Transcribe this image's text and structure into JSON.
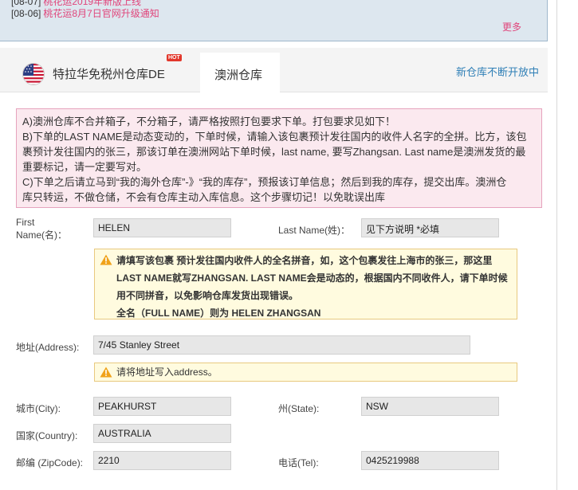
{
  "notices": {
    "clipped_row": {
      "date": "[08-07]",
      "title": "桃花运2019年新版上线"
    },
    "row2": {
      "date": "[08-06]",
      "title": "桃花运8月7日官网升级通知"
    },
    "more_label": "更多"
  },
  "tabs": {
    "us": {
      "label": "特拉华免税州仓库DE",
      "hot": "HOT",
      "flag_icon": "us-flag-icon"
    },
    "au": {
      "label": "澳洲仓库"
    },
    "new_warehouse": "新仓库不断开放中"
  },
  "instructions": {
    "line_a": "A)澳洲仓库不合并箱子，不分箱子，请严格按照打包要求下单。打包要求见如下！",
    "line_b1": "B)下单的LAST NAME是动态变动的，下单时候，请输入该包裹预计发往国内的收件人名字的全拼。比方，该包",
    "line_b2": "裹预计发往国内的张三，那该订单在澳洲网站下单时候，last name, 要写Zhangsan. Last name是澳洲发货的最",
    "line_b3": "重要标记，请一定要写对。",
    "line_c1": "C)下单之后请立马到“我的海外仓库”-》“我的库存”，预报该订单信息；然后到我的库存，提交出库。澳洲仓",
    "line_c2": "库只转运，不做仓储，不会有仓库主动入库信息。这个步骤切记！以免耽误出库"
  },
  "form": {
    "first_name": {
      "label_line1": "First",
      "label_line2": "Name(名)：",
      "value": "HELEN"
    },
    "last_name": {
      "label": "Last Name(姓)：",
      "value": "见下方说明 *必填"
    },
    "name_tip": {
      "line1": "请填写该包裹 预计发往国内收件人的全名拼音，如，这个包裹发往上海市的张三，那这里",
      "line2": "LAST NAME就写ZHANGSAN. LAST NAME会是动态的，根据国内不同收件人，请下单时候",
      "line3": "用不同拼音，以免影响仓库发货出现错误。",
      "line4": "全名（FULL NAME）则为 HELEN ZHANGSAN"
    },
    "address": {
      "label": "地址(Address):",
      "value": "7/45 Stanley Street"
    },
    "address_tip": "请将地址写入address。",
    "city": {
      "label": "城市(City):",
      "value": "PEAKHURST"
    },
    "state": {
      "label": "州(State):",
      "value": "NSW"
    },
    "country": {
      "label": "国家(Country):",
      "value": "AUSTRALIA"
    },
    "zip": {
      "label": "邮编 (ZipCode):",
      "value": "2210"
    },
    "phone": {
      "label": "电话(Tel):",
      "value": "0425219988"
    }
  },
  "colors": {
    "accent_pink": "#e0457b",
    "link_blue": "#2f7fb6",
    "warning_bg": "#fbe9ef",
    "tip_bg": "#fffbdf"
  }
}
